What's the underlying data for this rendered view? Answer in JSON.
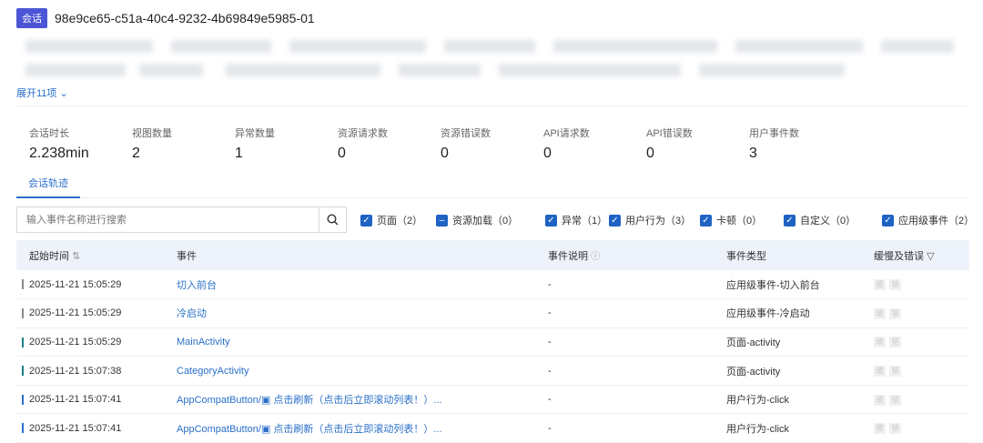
{
  "header": {
    "badge": "会话",
    "session_id": "98e9ce65-c51a-40c4-9232-4b69849e5985-01"
  },
  "expand_label": "展开11项",
  "stats": [
    {
      "label": "会话时长",
      "value": "2.238min"
    },
    {
      "label": "视图数量",
      "value": "2"
    },
    {
      "label": "异常数量",
      "value": "1"
    },
    {
      "label": "资源请求数",
      "value": "0"
    },
    {
      "label": "资源错误数",
      "value": "0"
    },
    {
      "label": "API请求数",
      "value": "0"
    },
    {
      "label": "API错误数",
      "value": "0"
    },
    {
      "label": "用户事件数",
      "value": "3"
    }
  ],
  "tab": "会话轨迹",
  "search": {
    "placeholder": "输入事件名称进行搜索"
  },
  "filters": [
    {
      "label": "页面（2）",
      "state": "checked"
    },
    {
      "label": "资源加载（0）",
      "state": "indeterminate"
    },
    {
      "label": "异常（1）",
      "state": "checked"
    },
    {
      "label": "用户行为（3）",
      "state": "checked"
    },
    {
      "label": "卡顿（0）",
      "state": "checked"
    },
    {
      "label": "自定义（0）",
      "state": "checked"
    },
    {
      "label": "应用级事件（2）",
      "state": "checked"
    }
  ],
  "table": {
    "headers": [
      "起始时间",
      "事件",
      "事件说明",
      "事件类型",
      "缓慢及错误"
    ],
    "rows": [
      {
        "time": "2025-11-21 15:05:29",
        "event": "切入前台",
        "desc": "-",
        "type": "应用级事件-切入前台",
        "color": "#888888"
      },
      {
        "time": "2025-11-21 15:05:29",
        "event": "冷启动",
        "desc": "-",
        "type": "应用级事件-冷启动",
        "color": "#888888"
      },
      {
        "time": "2025-11-21 15:05:29",
        "event": "MainActivity",
        "desc": "-",
        "type": "页面-activity",
        "color": "#1a7f86"
      },
      {
        "time": "2025-11-21 15:07:38",
        "event": "CategoryActivity",
        "desc": "-",
        "type": "页面-activity",
        "color": "#1a7f86"
      },
      {
        "time": "2025-11-21 15:07:41",
        "event": "AppCompatButton/▣ 点击刷新（点击后立即滚动列表！）...",
        "desc": "-",
        "type": "用户行为-click",
        "color": "#2a6fc9"
      },
      {
        "time": "2025-11-21 15:07:41",
        "event": "AppCompatButton/▣ 点击刷新（点击后立即滚动列表！）...",
        "desc": "-",
        "type": "用户行为-click",
        "color": "#2a6fc9"
      }
    ],
    "tags": [
      "缓",
      "错"
    ]
  }
}
